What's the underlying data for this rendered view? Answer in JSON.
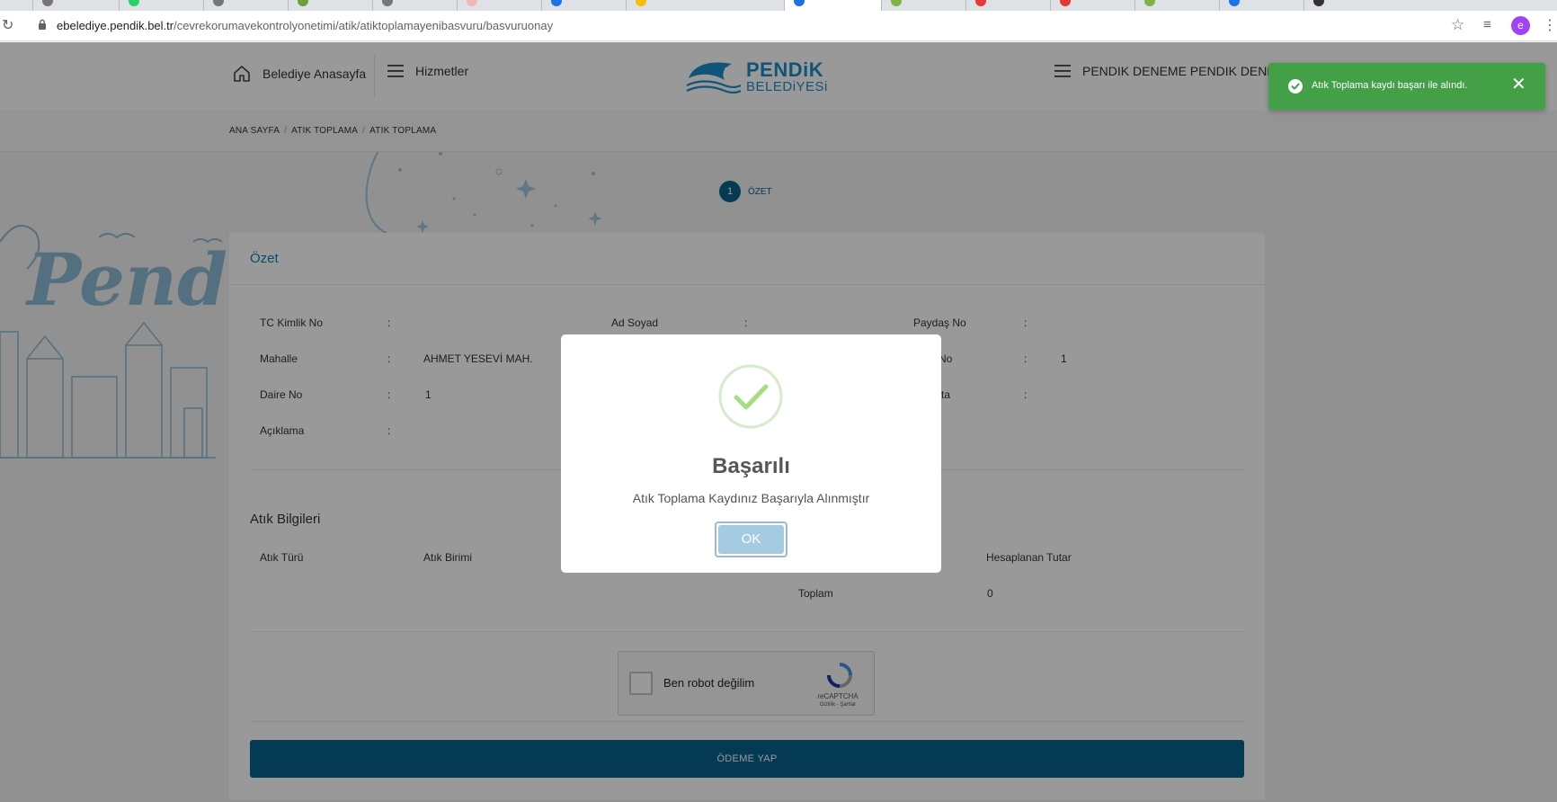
{
  "browser": {
    "url_host": "ebelediye.pendik.bel.tr",
    "url_path": "/cevrekorumavekontrolyonetimi/atik/atiktoplamayenibasvuru/basvuruonay",
    "avatar_letter": "e"
  },
  "header": {
    "home_label": "Belediye Anasayfa",
    "services_label": "Hizmetler",
    "logo_line1": "PENDiK",
    "logo_line2": "BELEDiYESi",
    "user_label": "PENDIK DENEME PENDIK DENEME"
  },
  "breadcrumb": [
    "ANA SAYFA",
    "ATIK TOPLAMA",
    "ATIK TOPLAMA"
  ],
  "stepper": {
    "number": "1",
    "label": "ÖZET"
  },
  "summary": {
    "title": "Özet",
    "fields": {
      "tc_label": "TC Kimlik No",
      "tc_value": "",
      "adsoyad_label": "Ad Soyad",
      "adsoyad_value": "",
      "paydas_label": "Paydaş No",
      "paydas_value": "",
      "mahalle_label": "Mahalle",
      "mahalle_value": "AHMET YESEVİ MAH.",
      "no_label_partial": "No",
      "no_value": "1",
      "daire_label": "Daire No",
      "daire_value": "1",
      "ta_label_partial": "ta",
      "ta_value": "",
      "aciklama_label": "Açıklama",
      "aciklama_value": "",
      "colon": ":"
    }
  },
  "waste": {
    "title": "Atık Bilgileri",
    "columns": {
      "type": "Atık Türü",
      "unit": "Atık Birimi",
      "total": "Hesaplanan Tutar"
    },
    "total_label": "Toplam",
    "total_value": "0"
  },
  "recaptcha": {
    "label": "Ben robot değilim",
    "brand": "reCAPTCHA",
    "links": "Gizlilik - Şartlar"
  },
  "pay_button": "ÖDEME YAP",
  "modal": {
    "title": "Başarılı",
    "message": "Atık Toplama Kaydınız Başarıyla Alınmıştır",
    "ok_label": "OK"
  },
  "toast": {
    "message": "Atık Toplama kaydı başarı ile alındı.",
    "color": "#43a047"
  },
  "colors": {
    "primary": "#07618b",
    "link": "#1a7bb0"
  }
}
